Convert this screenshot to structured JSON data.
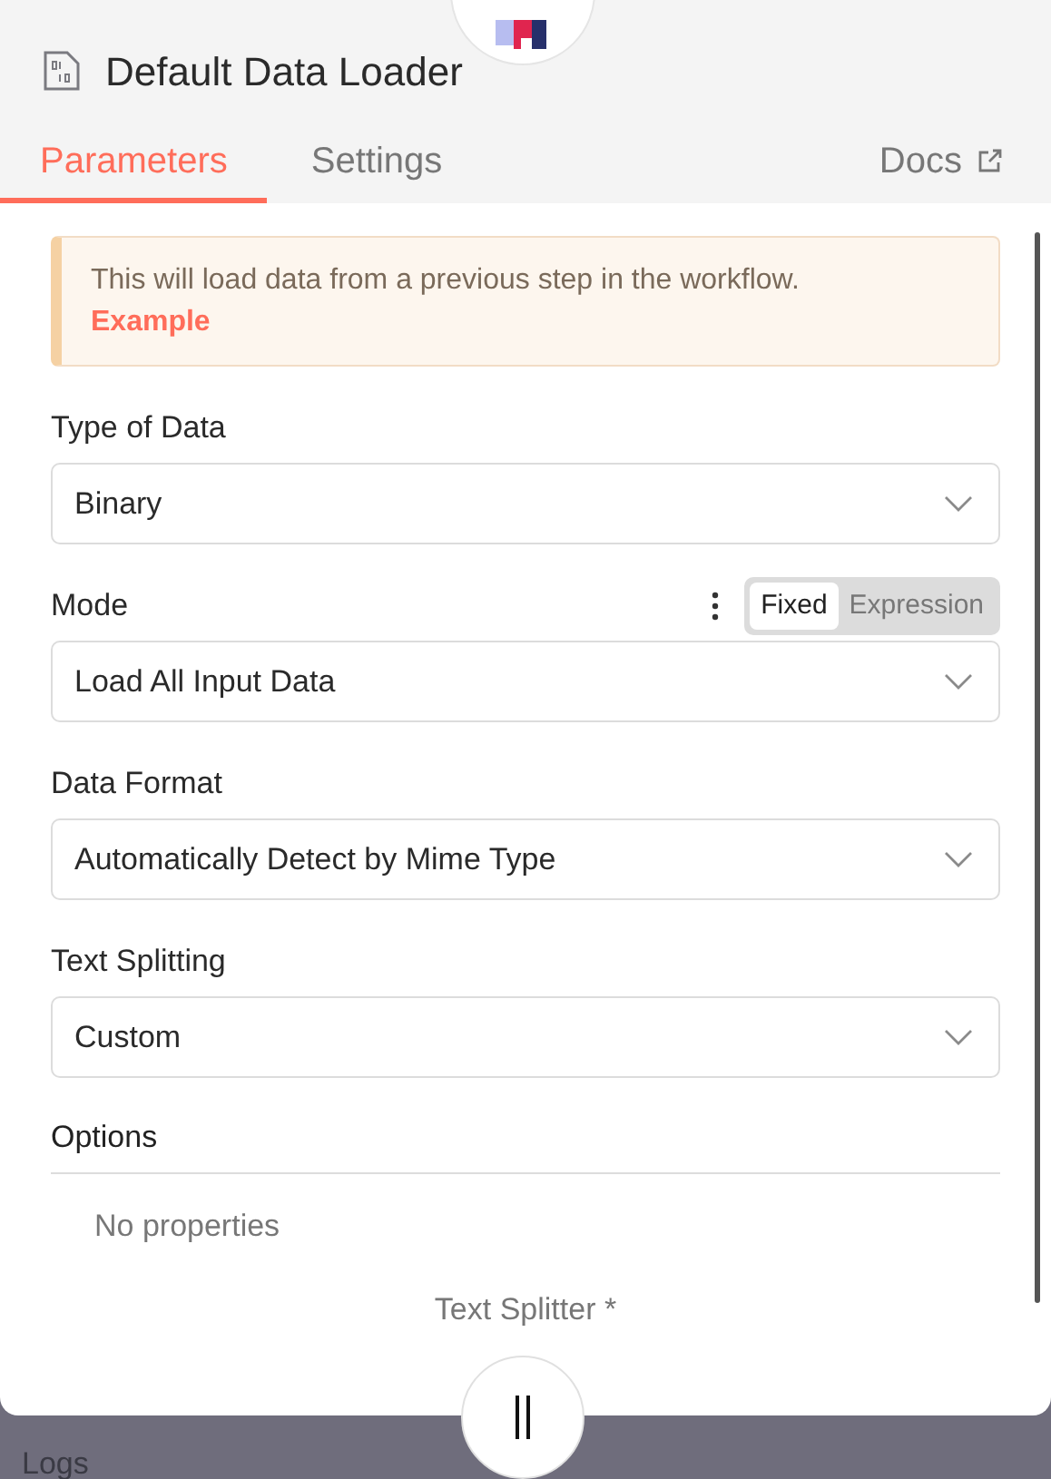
{
  "header": {
    "title": "Default Data Loader"
  },
  "tabs": [
    {
      "label": "Parameters",
      "selected": true
    },
    {
      "label": "Settings",
      "selected": false
    }
  ],
  "docs_link": "Docs",
  "notice": {
    "text": "This will load data from a previous step in the workflow.",
    "link": "Example"
  },
  "fields": [
    {
      "label": "Type of Data",
      "value": "Binary"
    },
    {
      "label": "Mode",
      "value": "Load All Input Data",
      "toggle": [
        {
          "label": "Fixed",
          "selected": true
        },
        {
          "label": "Expression",
          "selected": false
        }
      ]
    },
    {
      "label": "Data Format",
      "value": "Automatically Detect by Mime Type"
    },
    {
      "label": "Text Splitting",
      "value": "Custom"
    }
  ],
  "options": {
    "title": "Options",
    "empty_text": "No properties"
  },
  "sub_node_label": "Text Splitter *",
  "bottom_bar": {
    "label": "Logs"
  }
}
